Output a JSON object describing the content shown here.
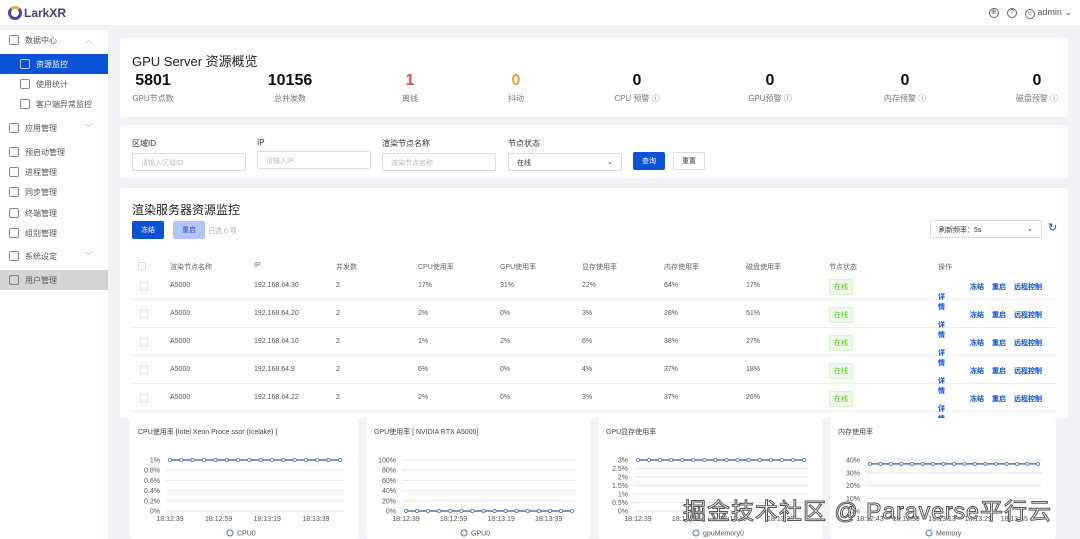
{
  "header": {
    "brand": "LarkXR",
    "user": "admin"
  },
  "sidebar": {
    "items": [
      {
        "label": "数据中心",
        "icon": "chart-icon"
      },
      {
        "label": "资源监控",
        "icon": "monitor-icon"
      },
      {
        "label": "使用统计",
        "icon": "pie-icon"
      },
      {
        "label": "客户端异常监控",
        "icon": "file-icon"
      },
      {
        "label": "应用管理",
        "icon": "apps-icon"
      },
      {
        "label": "预启动管理",
        "icon": "folder-icon"
      },
      {
        "label": "进程管理",
        "icon": "doc-icon"
      },
      {
        "label": "同步管理",
        "icon": "check-icon"
      },
      {
        "label": "终端管理",
        "icon": "server-icon"
      },
      {
        "label": "组别管理",
        "icon": "layers-icon"
      },
      {
        "label": "系统设定",
        "icon": "settings-icon"
      },
      {
        "label": "用户管理",
        "icon": "user-icon"
      }
    ]
  },
  "overview": {
    "title": "GPU Server 资源概览",
    "stats": [
      {
        "value": "5801",
        "label": "GPU节点数",
        "color": "#111111"
      },
      {
        "value": "10156",
        "label": "总并发数",
        "color": "#111111"
      },
      {
        "value": "1",
        "label": "离线",
        "color": "#d9534f"
      },
      {
        "value": "0",
        "label": "抖动",
        "color": "#e6a23c"
      },
      {
        "value": "0",
        "label": "CPU 预警",
        "color": "#111111"
      },
      {
        "value": "0",
        "label": "GPU预警",
        "color": "#111111"
      },
      {
        "value": "0",
        "label": "内存预警",
        "color": "#111111"
      },
      {
        "value": "0",
        "label": "磁盘预警",
        "color": "#111111"
      }
    ]
  },
  "filter": {
    "region_label": "区域ID",
    "region_placeholder": "请输入区域ID",
    "ip_label": "IP",
    "ip_placeholder": "请输入IP",
    "name_label": "渲染节点名称",
    "name_placeholder": "渲染节点名称",
    "status_label": "节点状态",
    "status_value": "在线",
    "query": "查询",
    "reset": "重置"
  },
  "table": {
    "title": "渲染服务器资源监控",
    "freeze": "冻结",
    "restart": "重启",
    "selected": "已选 0 项",
    "refresh": "刷新频率：5s",
    "columns": [
      "渲染节点名称",
      "IP",
      "并发数",
      "CPU使用率",
      "GPU使用率",
      "显存使用率",
      "内存使用率",
      "磁盘使用率",
      "节点状态",
      "操作"
    ],
    "actions": {
      "detail": "详情",
      "freeze": "冻结",
      "restart": "重启",
      "remote": "远程控制"
    },
    "rows": [
      [
        "A5000",
        "192.168.64.30",
        "2",
        "17%",
        "31%",
        "22%",
        "64%",
        "17%",
        "在线"
      ],
      [
        "A5000",
        "192.168.64.20",
        "2",
        "2%",
        "0%",
        "3%",
        "28%",
        "51%",
        "在线"
      ],
      [
        "A5000",
        "192.168.64.10",
        "2",
        "1%",
        "2%",
        "6%",
        "38%",
        "27%",
        "在线"
      ],
      [
        "A5000",
        "192.168.64.9",
        "2",
        "6%",
        "0%",
        "4%",
        "37%",
        "18%",
        "在线"
      ],
      [
        "A5000",
        "192.168.64.22",
        "2",
        "2%",
        "0%",
        "3%",
        "37%",
        "26%",
        "在线"
      ]
    ]
  },
  "chart_data": [
    {
      "type": "line",
      "title": "CPU使用率 [Intel Xeon Proce ssor (Icelake) ]",
      "series": [
        {
          "name": "CPU0",
          "values": [
            1,
            1,
            1,
            1,
            1,
            1,
            1,
            1,
            1,
            1,
            1,
            1,
            1,
            1,
            1,
            1
          ]
        }
      ],
      "xticks": [
        "18:12:39",
        "18:12:59",
        "18:13:19",
        "18:13:39"
      ],
      "yticks": [
        "0%",
        "0.2%",
        "0.4%",
        "0.6%",
        "0.8%",
        "1%"
      ],
      "ylim": [
        0,
        1
      ]
    },
    {
      "type": "line",
      "title": "GPU使用率 [ NVIDIA RTX A5000]",
      "series": [
        {
          "name": "GPU0",
          "values": [
            0,
            0,
            0,
            0,
            0,
            0,
            0,
            0,
            0,
            0,
            0,
            0,
            0,
            0,
            0,
            0
          ]
        }
      ],
      "xticks": [
        "18:12:39",
        "18:12:59",
        "18:13:19",
        "18:13:39"
      ],
      "yticks": [
        "0%",
        "20%",
        "40%",
        "60%",
        "80%",
        "100%"
      ],
      "ylim": [
        0,
        100
      ]
    },
    {
      "type": "line",
      "title": "GPU显存使用率",
      "series": [
        {
          "name": "gpuMemory0",
          "values": [
            3,
            3,
            3,
            3,
            3,
            3,
            3,
            3,
            3,
            3,
            3,
            3,
            3,
            3,
            3,
            3
          ]
        }
      ],
      "xticks": [
        "18:12:39",
        "18:12:59",
        "18:13:19",
        "18:13:39"
      ],
      "yticks": [
        "0%",
        "0.5%",
        "1%",
        "1.5%",
        "2%",
        "2.5%",
        "3%"
      ],
      "ylim": [
        0,
        3
      ]
    },
    {
      "type": "line",
      "title": "内存使用率",
      "series": [
        {
          "name": "Memory",
          "values": [
            37,
            37,
            37,
            37,
            37,
            37,
            37,
            37,
            37,
            37,
            37,
            37,
            37,
            37,
            37,
            37,
            37
          ]
        }
      ],
      "xticks": [
        "18:12:43",
        "18:12:59",
        "18:13:13",
        "18:13:29",
        "18:13:45"
      ],
      "yticks": [
        "0%",
        "10%",
        "20%",
        "30%",
        "40%"
      ],
      "ylim": [
        0,
        40
      ]
    }
  ],
  "watermark": "掘金技术社区 @ Paraverse平行云"
}
